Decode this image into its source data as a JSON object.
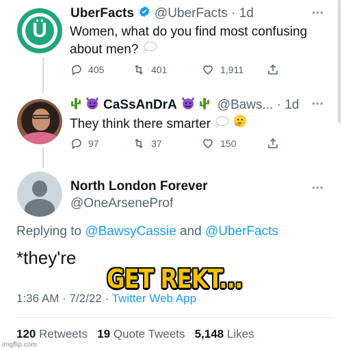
{
  "tweet1": {
    "name": "UberFacts",
    "handle": "@UberFacts · 1d",
    "text": "Women, what do you find most confusing about men?",
    "replies": "405",
    "retweets": "401",
    "likes": "1,911",
    "avatar_letter": "Ü"
  },
  "tweet2": {
    "name": "CaSsAnDrA",
    "handle": "@Baws... · 1d",
    "text": "They think there smarter",
    "replies": "97",
    "retweets": "37",
    "likes": "150"
  },
  "tweet3": {
    "name": "North London Forever",
    "handle": "@OneArseneProf",
    "replying_prefix": "Replying to",
    "replying_user1": "@BawsyCassie",
    "replying_and": "and",
    "replying_user2": "@UberFacts",
    "text": "*they're",
    "time": "1:36 AM · 7/2/22 ·",
    "source": "Twitter Web App",
    "retweets_count": "120",
    "retweets_label": "Retweets",
    "quotes_count": "19",
    "quotes_label": "Quote Tweets",
    "likes_count": "5,148",
    "likes_label": "Likes"
  },
  "overlay": {
    "caption": "GET REKT..."
  },
  "watermark": "imgflip.com",
  "colors": {
    "brand_green": "#1fa67a",
    "link_blue": "#1d9bf0",
    "caption_yellow": "#f2c200",
    "muted_gray": "#536471"
  },
  "icons": [
    "more-dots-icon",
    "verified-badge-icon",
    "reply-icon",
    "retweet-icon",
    "like-icon",
    "share-icon",
    "cactus-emoji-icon",
    "devil-emoji-icon",
    "thought-bubble-icon",
    "thinking-face-icon",
    "default-avatar-icon"
  ]
}
